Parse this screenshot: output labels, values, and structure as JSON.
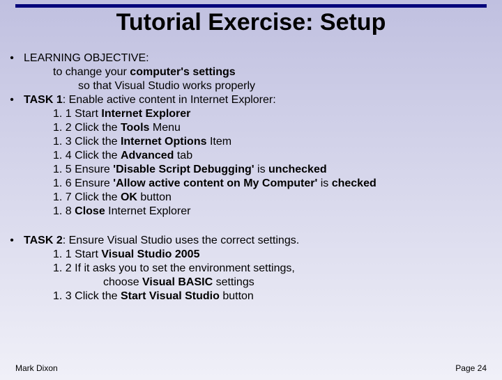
{
  "title": "Tutorial Exercise: Setup",
  "b1": {
    "label": "LEARNING OBJECTIVE:",
    "l1a": "to change your ",
    "l1b": "computer's settings",
    "l2": "so that Visual Studio works properly"
  },
  "b2": {
    "head_a": "TASK 1",
    "head_b": ": Enable active content in Internet Explorer:",
    "s1a": "1. 1 Start ",
    "s1b": "Internet Explorer",
    "s2a": "1. 2 Click the ",
    "s2b": "Tools",
    "s2c": " Menu",
    "s3a": "1. 3 Click the ",
    "s3b": "Internet Options",
    "s3c": " Item",
    "s4a": "1. 4 Click the ",
    "s4b": "Advanced",
    "s4c": " tab",
    "s5a": "1. 5 Ensure ",
    "s5b": "'Disable Script Debugging'",
    "s5c": " is ",
    "s5d": "unchecked",
    "s6a": "1. 6 Ensure ",
    "s6b": "'Allow active content on My Computer'",
    "s6c": " is ",
    "s6d": "checked",
    "s7a": "1. 7 Click the ",
    "s7b": "OK",
    "s7c": " button",
    "s8a": "1. 8 ",
    "s8b": "Close",
    "s8c": " Internet Explorer"
  },
  "b3": {
    "head_a": "TASK 2",
    "head_b": ": Ensure Visual Studio uses the correct settings.",
    "s1a": "1. 1 Start ",
    "s1b": "Visual Studio 2005",
    "s2": "1. 2 If it asks you to set the environment settings,",
    "s2ca": "choose ",
    "s2cb": "Visual BASIC",
    "s2cc": " settings",
    "s3a": "1. 3 Click the ",
    "s3b": "Start Visual Studio",
    "s3c": " button"
  },
  "footer": {
    "author": "Mark Dixon",
    "page": "Page 24"
  }
}
